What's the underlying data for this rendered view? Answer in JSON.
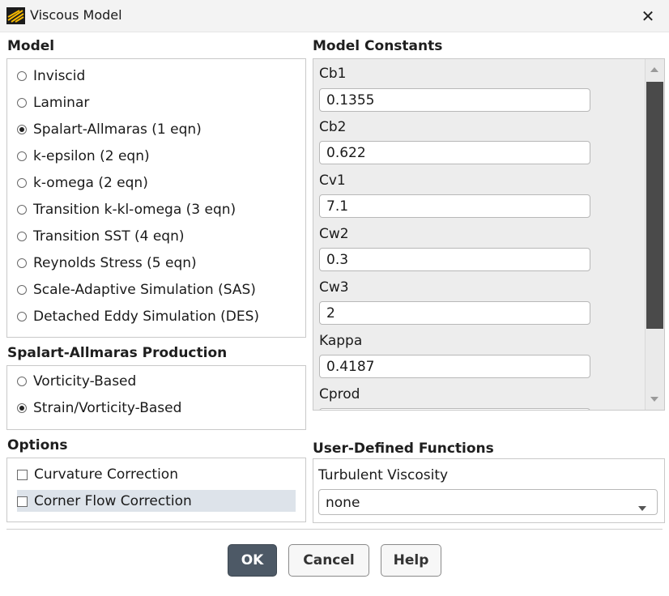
{
  "window": {
    "title": "Viscous Model"
  },
  "model": {
    "title": "Model",
    "options": [
      {
        "label": "Inviscid",
        "selected": false
      },
      {
        "label": "Laminar",
        "selected": false
      },
      {
        "label": "Spalart-Allmaras (1 eqn)",
        "selected": true
      },
      {
        "label": "k-epsilon (2 eqn)",
        "selected": false
      },
      {
        "label": "k-omega (2 eqn)",
        "selected": false
      },
      {
        "label": "Transition k-kl-omega (3 eqn)",
        "selected": false
      },
      {
        "label": "Transition SST (4 eqn)",
        "selected": false
      },
      {
        "label": "Reynolds Stress (5 eqn)",
        "selected": false
      },
      {
        "label": "Scale-Adaptive Simulation (SAS)",
        "selected": false
      },
      {
        "label": "Detached Eddy Simulation (DES)",
        "selected": false
      }
    ]
  },
  "production": {
    "title": "Spalart-Allmaras Production",
    "options": [
      {
        "label": "Vorticity-Based",
        "selected": false
      },
      {
        "label": "Strain/Vorticity-Based",
        "selected": true
      }
    ]
  },
  "options": {
    "title": "Options",
    "items": [
      {
        "label": "Curvature Correction",
        "checked": false
      },
      {
        "label": "Corner Flow Correction",
        "checked": false
      }
    ]
  },
  "constants": {
    "title": "Model Constants",
    "items": [
      {
        "label": "Cb1",
        "value": "0.1355"
      },
      {
        "label": "Cb2",
        "value": "0.622"
      },
      {
        "label": "Cv1",
        "value": "7.1"
      },
      {
        "label": "Cw2",
        "value": "0.3"
      },
      {
        "label": "Cw3",
        "value": "2"
      },
      {
        "label": "Kappa",
        "value": "0.4187"
      },
      {
        "label": "Cprod",
        "value": ""
      }
    ]
  },
  "udf": {
    "title": "User-Defined Functions",
    "turbulent_viscosity_label": "Turbulent Viscosity",
    "turbulent_viscosity_value": "none"
  },
  "buttons": {
    "ok": "OK",
    "cancel": "Cancel",
    "help": "Help"
  },
  "colors": {
    "primary_button": "#4d5966",
    "highlight_row": "#dde3ea",
    "scroll_thumb": "#4a4a4a"
  }
}
